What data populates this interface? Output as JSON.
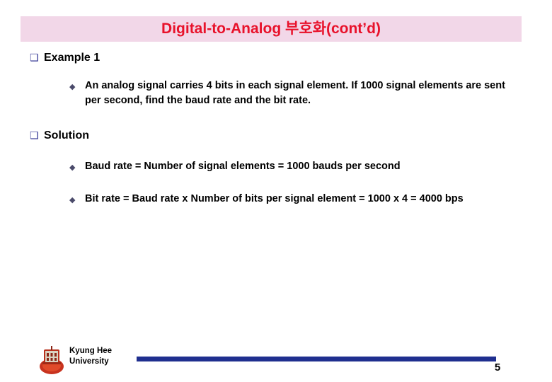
{
  "slide": {
    "title": "Digital-to-Analog 부호화(cont’d)",
    "title_color": "#e8122b",
    "title_band_color": "#f2d7e8",
    "bullets": {
      "example_heading": "Example 1",
      "example_body": "An analog signal carries 4 bits in each signal element. If 1000 signal elements are sent per second, find the baud rate and the bit rate.",
      "solution_heading": "Solution",
      "solution_line1": "Baud rate = Number of signal elements =  1000 bauds per second",
      "solution_line2": "Bit rate = Baud rate x Number of bits per signal element = 1000 x 4 = 4000 bps"
    },
    "bullet_glyphs": {
      "level1": "❑",
      "level2": "◆"
    },
    "footer": {
      "org_line1": "Kyung Hee",
      "org_line2": "University",
      "rule_color": "#1f2f8f",
      "page_number": "5"
    }
  }
}
